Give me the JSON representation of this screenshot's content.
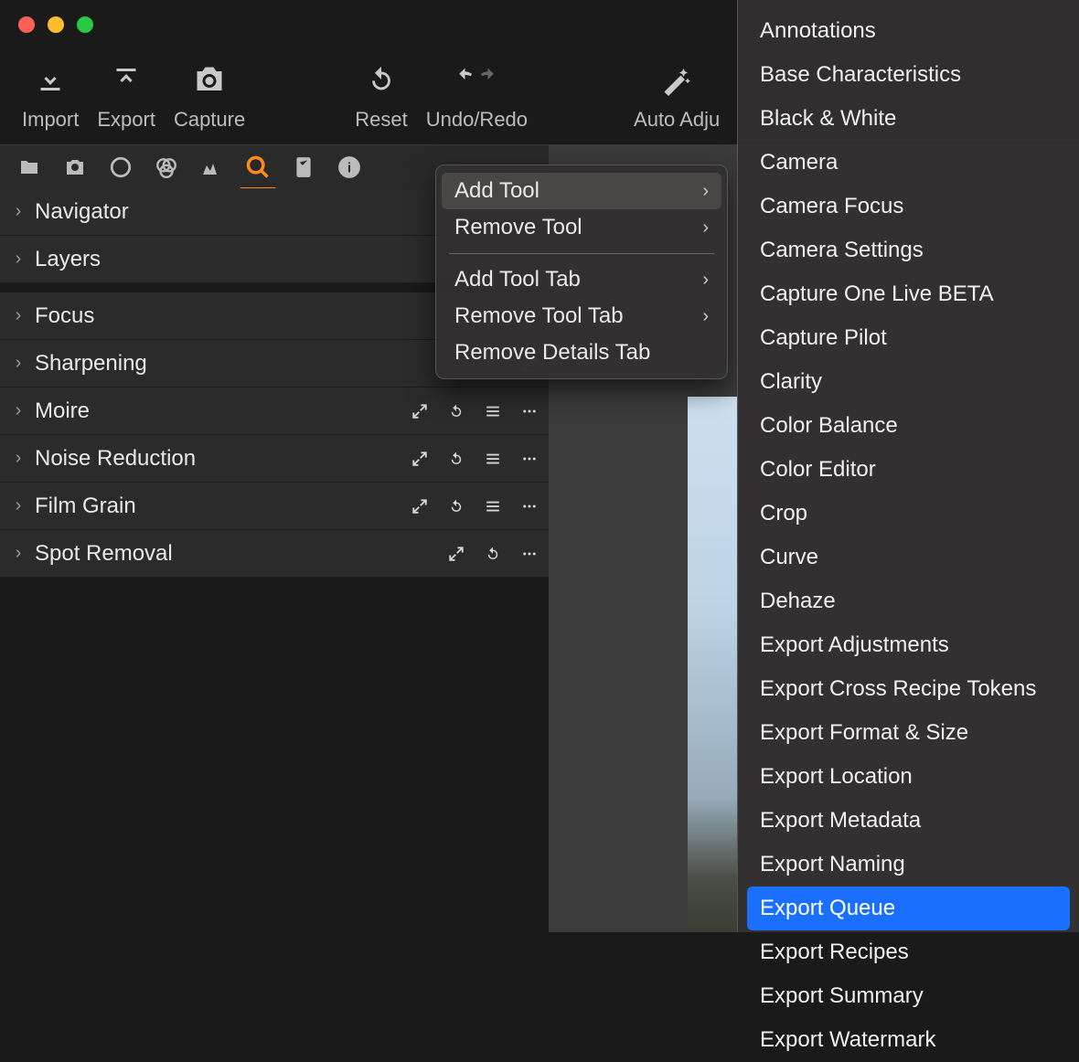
{
  "toolbar": {
    "import": "Import",
    "export": "Export",
    "capture": "Capture",
    "reset": "Reset",
    "undoredo": "Undo/Redo",
    "autoadjust": "Auto Adju"
  },
  "panels": [
    {
      "name": "Navigator",
      "expand": false,
      "reset": false,
      "presets": false,
      "more": false
    },
    {
      "name": "Layers",
      "expand": false,
      "reset": false,
      "presets": false,
      "more": false
    },
    {
      "gap": true
    },
    {
      "name": "Focus",
      "expand": false,
      "reset": false,
      "presets": false,
      "more": false
    },
    {
      "name": "Sharpening",
      "expand": true,
      "reset": false,
      "presets": false,
      "more": false
    },
    {
      "name": "Moire",
      "expand": true,
      "reset": true,
      "presets": true,
      "more": true
    },
    {
      "name": "Noise Reduction",
      "expand": true,
      "reset": true,
      "presets": true,
      "more": true
    },
    {
      "name": "Film Grain",
      "expand": true,
      "reset": true,
      "presets": true,
      "more": true
    },
    {
      "name": "Spot Removal",
      "expand": true,
      "reset": true,
      "presets": false,
      "more": true
    }
  ],
  "contextMenu": [
    {
      "label": "Add Tool",
      "submenu": true,
      "hover": true
    },
    {
      "label": "Remove Tool",
      "submenu": true
    },
    {
      "sep": true
    },
    {
      "label": "Add Tool Tab",
      "submenu": true
    },
    {
      "label": "Remove Tool Tab",
      "submenu": true
    },
    {
      "label": "Remove Details Tab"
    }
  ],
  "submenuItems": [
    "Annotations",
    "Base Characteristics",
    "Black & White",
    "Camera",
    "Camera Focus",
    "Camera Settings",
    "Capture One Live BETA",
    "Capture Pilot",
    "Clarity",
    "Color Balance",
    "Color Editor",
    "Crop",
    "Curve",
    "Dehaze",
    "Export Adjustments",
    "Export Cross Recipe Tokens",
    "Export Format & Size",
    "Export Location",
    "Export Metadata",
    "Export Naming",
    "Export Queue",
    "Export Recipes",
    "Export Summary",
    "Export Watermark"
  ],
  "selectedSubmenu": "Export Queue"
}
